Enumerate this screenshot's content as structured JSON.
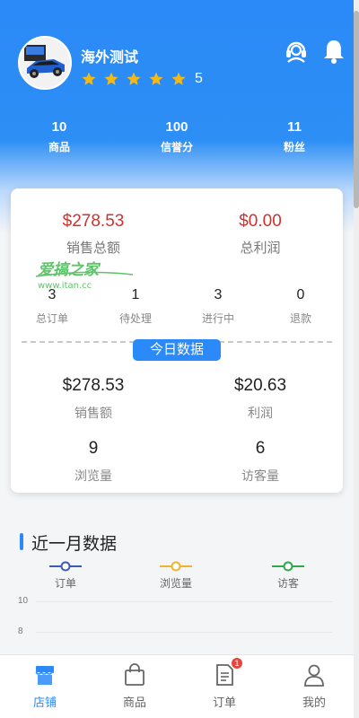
{
  "profile": {
    "shop_name": "海外测试",
    "rating": "5",
    "star_count": 5
  },
  "header_icons": [
    "customer-service-icon",
    "bell-icon"
  ],
  "stats": [
    {
      "value": "10",
      "label": "商品"
    },
    {
      "value": "100",
      "label": "信誉分"
    },
    {
      "value": "11",
      "label": "粉丝"
    }
  ],
  "summary": {
    "total_sales": {
      "value": "$278.53",
      "label": "销售总额"
    },
    "total_profit": {
      "value": "$0.00",
      "label": "总利润"
    },
    "watermark_text": "爱搞之家",
    "watermark_url": "www.itan.cc",
    "orders": [
      {
        "value": "3",
        "label": "总订单"
      },
      {
        "value": "1",
        "label": "待处理"
      },
      {
        "value": "3",
        "label": "进行中"
      },
      {
        "value": "0",
        "label": "退款"
      }
    ]
  },
  "today": {
    "badge": "今日数据",
    "sales": {
      "value": "$278.53",
      "label": "销售额"
    },
    "profit": {
      "value": "$20.63",
      "label": "利润"
    },
    "views": {
      "value": "9",
      "label": "浏览量"
    },
    "visitors": {
      "value": "6",
      "label": "访客量"
    }
  },
  "monthly": {
    "title": "近一月数据"
  },
  "chart_data": {
    "type": "line",
    "title": "近一月数据",
    "series": [
      {
        "name": "订单",
        "color": "#3b5bb5",
        "values": []
      },
      {
        "name": "浏览量",
        "color": "#f0b429",
        "values": []
      },
      {
        "name": "访客",
        "color": "#2ea84a",
        "values": []
      }
    ],
    "y_ticks": [
      "10",
      "8"
    ],
    "grid": true,
    "legend": "top"
  },
  "tabs": [
    {
      "label": "店铺",
      "icon": "store-icon",
      "active": true
    },
    {
      "label": "商品",
      "icon": "shopping-bag-icon",
      "active": false
    },
    {
      "label": "订单",
      "icon": "order-document-icon",
      "active": false,
      "badge": "1"
    },
    {
      "label": "我的",
      "icon": "user-icon",
      "active": false
    }
  ],
  "colors": {
    "primary": "#2b8af7",
    "highlight_red": "#d0312d",
    "badge_red": "#e8453c",
    "star": "#f5b915"
  }
}
